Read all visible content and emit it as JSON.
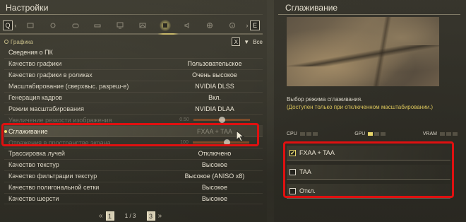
{
  "left_panel": {
    "title": "Настройки",
    "tab_left_key": "Q",
    "tab_right_key": "E",
    "tabs": [
      {
        "icon": "display-icon"
      },
      {
        "icon": "camera-icon"
      },
      {
        "icon": "gamepad-icon"
      },
      {
        "icon": "controller-icon"
      },
      {
        "icon": "monitor-icon"
      },
      {
        "icon": "image-icon"
      },
      {
        "icon": "graphics-icon",
        "active": true
      },
      {
        "icon": "audio-icon"
      },
      {
        "icon": "network-icon"
      },
      {
        "icon": "info-icon"
      }
    ],
    "category": "Графика",
    "filter_key": "X",
    "filter_label": "Все",
    "rows": [
      {
        "label": "Сведения о ПК",
        "value": ""
      },
      {
        "label": "Качество графики",
        "value": "Пользовательское"
      },
      {
        "label": "Качество графики в роликах",
        "value": "Очень высокое"
      },
      {
        "label": "Масштабирование (сверхвыс. разреш-е)",
        "value": "NVIDIA DLSS"
      },
      {
        "label": "Генерация кадров",
        "value": "Вкл."
      },
      {
        "label": "Режим масштабирования",
        "value": "NVIDIA DLAA"
      },
      {
        "label": "Увеличение резкости изображения",
        "value": "0.50",
        "slider": 0.5
      },
      {
        "label": "Сглаживание",
        "value": "FXAA + TAA"
      },
      {
        "label": "Отражения в пространстве экрана",
        "value": "100",
        "slider": 0.6
      },
      {
        "label": "Трассировка лучей",
        "value": "Отключено"
      },
      {
        "label": "Качество текстур",
        "value": "Высокое"
      },
      {
        "label": "Качество фильтрации текстур",
        "value": "Высокое (ANISO x8)"
      },
      {
        "label": "Качество полигональной сетки",
        "value": "Высокое"
      },
      {
        "label": "Качество шерсти",
        "value": "Высокое"
      }
    ],
    "pager": {
      "prev_key": "1",
      "next_key": "3",
      "page": "1 / 3"
    }
  },
  "right_panel": {
    "title": "Сглаживание",
    "desc_line1": "Выбор режима сглаживания.",
    "desc_line2": "(Доступен только при отключенном масштабировании.)",
    "meters": [
      {
        "label": "CPU",
        "level": 0
      },
      {
        "label": "GPU",
        "level": 1
      },
      {
        "label": "VRAM",
        "level": 0
      }
    ],
    "options": [
      {
        "label": "FXAA + TAA",
        "checked": true
      },
      {
        "label": "TAA",
        "checked": false
      },
      {
        "label": "Откл.",
        "checked": false
      }
    ]
  },
  "colors": {
    "highlight_red": "#e01010",
    "accent_yellow": "#e8d66a"
  }
}
